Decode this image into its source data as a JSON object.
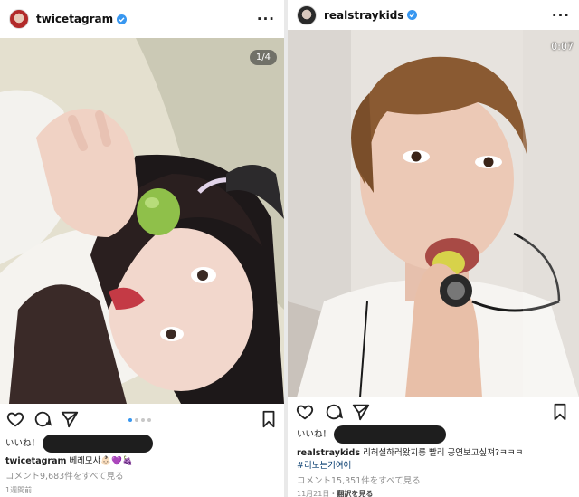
{
  "left_post": {
    "username": "twicetagram",
    "more_label": "···",
    "photo_counter": "1/4",
    "likes_label": "いいね！",
    "caption_user": "twicetagram",
    "caption_text": "베레모샤👶🏻💜🍇",
    "comments_label": "コメント9,683件をすべて見る",
    "timestamp": "1週間前",
    "icons": [
      "heart-icon",
      "comment-icon",
      "share-icon",
      "bookmark-icon",
      "verified-badge-icon"
    ],
    "colors": {
      "accent": "#3897f0",
      "verified": "#3897f0",
      "avatar": "#b22a2a"
    }
  },
  "right_post": {
    "username": "realstraykids",
    "more_label": "···",
    "video_time": "0:07",
    "likes_label": "いいね！",
    "caption_user": "realstraykids",
    "caption_text": "리허설하러왔지롱 빨리 공연보고싶져?ㅋㅋㅋ",
    "hashtag": "#리노는기여어",
    "comments_label": "コメント15,351件をすべて見る",
    "timestamp": "11月21日・",
    "translation_label": "翻訳を見る",
    "icons": [
      "heart-icon",
      "comment-icon",
      "share-icon",
      "bookmark-icon",
      "verified-badge-icon"
    ],
    "colors": {
      "accent": "#3897f0",
      "verified": "#3897f0",
      "avatar": "#2a2a2a"
    }
  }
}
